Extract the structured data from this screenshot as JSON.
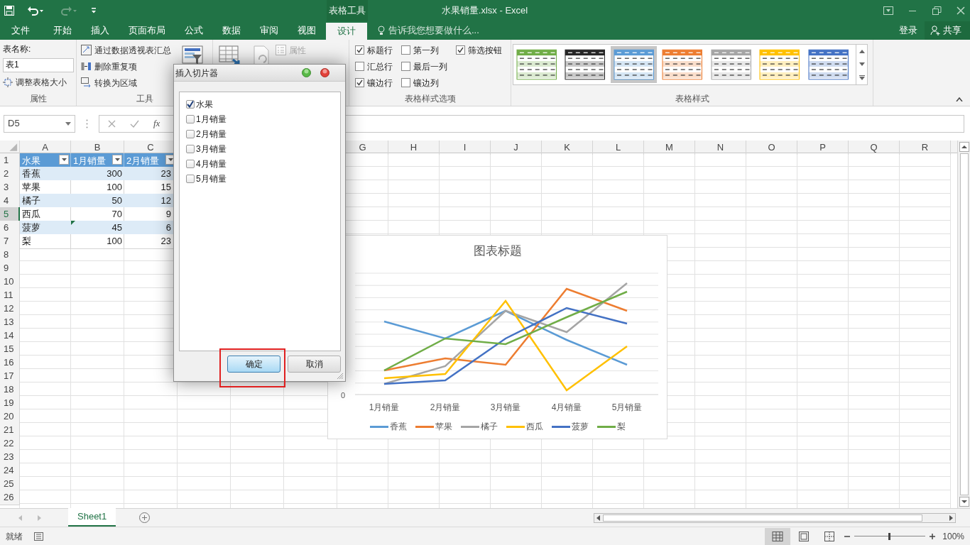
{
  "title_bar": {
    "context_tab": "表格工具",
    "title": "水果销量.xlsx - Excel"
  },
  "ribbon_tabs": [
    {
      "label": "文件",
      "selected": false
    },
    {
      "label": "开始",
      "selected": false
    },
    {
      "label": "插入",
      "selected": false
    },
    {
      "label": "页面布局",
      "selected": false
    },
    {
      "label": "公式",
      "selected": false
    },
    {
      "label": "数据",
      "selected": false
    },
    {
      "label": "审阅",
      "selected": false
    },
    {
      "label": "视图",
      "selected": false
    },
    {
      "label": "设计",
      "selected": true
    }
  ],
  "tell_me": "告诉我您想要做什么...",
  "account": {
    "sign_in": "登录",
    "share": "共享"
  },
  "ribbon": {
    "properties": {
      "group": "属性",
      "name_label": "表名称:",
      "name_value": "表1",
      "resize": "调整表格大小"
    },
    "tools": {
      "group": "工具",
      "items": [
        "通过数据透视表汇总",
        "删除重复项",
        "转换为区域"
      ]
    },
    "external": {
      "properties": "属性"
    },
    "style_options": {
      "group": "表格样式选项",
      "options": [
        {
          "label": "标题行",
          "checked": true
        },
        {
          "label": "汇总行",
          "checked": false
        },
        {
          "label": "镶边行",
          "checked": true
        },
        {
          "label": "第一列",
          "checked": false
        },
        {
          "label": "最后一列",
          "checked": false
        },
        {
          "label": "镶边列",
          "checked": false
        },
        {
          "label": "筛选按钮",
          "checked": true
        }
      ]
    },
    "table_styles": {
      "group": "表格样式",
      "styles": [
        {
          "color": "#70ad47",
          "selected": false
        },
        {
          "color": "#262626",
          "selected": false
        },
        {
          "color": "#5b9bd5",
          "selected": true
        },
        {
          "color": "#ed7d31",
          "selected": false
        },
        {
          "color": "#a5a5a5",
          "selected": false
        },
        {
          "color": "#ffc000",
          "selected": false
        },
        {
          "color": "#4472c4",
          "selected": false
        }
      ]
    }
  },
  "formula_bar": {
    "name_box": "D5",
    "function_label": "fx"
  },
  "sheet": {
    "columns": [
      "A",
      "B",
      "C",
      "G",
      "H",
      "I",
      "J",
      "K",
      "L",
      "M",
      "N",
      "O",
      "P",
      "Q",
      "R"
    ],
    "row_headers": [
      {
        "label": "1",
        "selected": false
      },
      {
        "label": "2",
        "selected": false
      },
      {
        "label": "3",
        "selected": false
      },
      {
        "label": "4",
        "selected": false
      },
      {
        "label": "5",
        "selected": true
      },
      {
        "label": "6",
        "selected": false
      },
      {
        "label": "7",
        "selected": false
      },
      {
        "label": "8",
        "selected": false
      },
      {
        "label": "9",
        "selected": false
      },
      {
        "label": "10",
        "selected": false
      },
      {
        "label": "11",
        "selected": false
      },
      {
        "label": "12",
        "selected": false
      },
      {
        "label": "13",
        "selected": false
      },
      {
        "label": "14",
        "selected": false
      },
      {
        "label": "15",
        "selected": false
      },
      {
        "label": "16",
        "selected": false
      },
      {
        "label": "17",
        "selected": false
      },
      {
        "label": "18",
        "selected": false
      },
      {
        "label": "19",
        "selected": false
      },
      {
        "label": "20",
        "selected": false
      },
      {
        "label": "21",
        "selected": false
      },
      {
        "label": "22",
        "selected": false
      },
      {
        "label": "23",
        "selected": false
      },
      {
        "label": "24",
        "selected": false
      },
      {
        "label": "25",
        "selected": false
      },
      {
        "label": "26",
        "selected": false
      }
    ],
    "table_header": [
      "水果",
      "1月销量",
      "2月销量"
    ],
    "table_rows": [
      {
        "cells": [
          "香蕉",
          "300",
          "23"
        ],
        "warning": false
      },
      {
        "cells": [
          "苹果",
          "100",
          "15"
        ],
        "warning": false
      },
      {
        "cells": [
          "橘子",
          "50",
          "12"
        ],
        "warning": false
      },
      {
        "cells": [
          "西瓜",
          "70",
          "9"
        ],
        "warning": false
      },
      {
        "cells": [
          "菠萝",
          "45",
          "6"
        ],
        "warning": true
      },
      {
        "cells": [
          "梨",
          "100",
          "23"
        ],
        "warning": false
      }
    ]
  },
  "chart": {
    "title": "图表标题",
    "y_axis_label": "0",
    "categories": [
      "1月销量",
      "2月销量",
      "3月销量",
      "4月销量",
      "5月销量"
    ],
    "legend": [
      {
        "name": "香蕉",
        "color": "#5b9bd5"
      },
      {
        "name": "苹果",
        "color": "#ed7d31"
      },
      {
        "name": "橘子",
        "color": "#a5a5a5"
      },
      {
        "name": "西瓜",
        "color": "#ffc000"
      },
      {
        "name": "菠萝",
        "color": "#4472c4"
      },
      {
        "name": "梨",
        "color": "#70ad47"
      }
    ]
  },
  "dialog": {
    "title": "插入切片器",
    "fields": [
      {
        "label": "水果",
        "checked": true
      },
      {
        "label": "1月销量",
        "checked": false
      },
      {
        "label": "2月销量",
        "checked": false
      },
      {
        "label": "3月销量",
        "checked": false
      },
      {
        "label": "4月销量",
        "checked": false
      },
      {
        "label": "5月销量",
        "checked": false
      }
    ],
    "buttons": [
      {
        "label": "确定",
        "default": true,
        "highlighted": true
      },
      {
        "label": "取消",
        "default": false,
        "highlighted": false
      }
    ]
  },
  "sheet_tabs": [
    {
      "label": "Sheet1",
      "selected": true
    }
  ],
  "status_bar": {
    "status": "就绪",
    "zoom": "100%"
  }
}
